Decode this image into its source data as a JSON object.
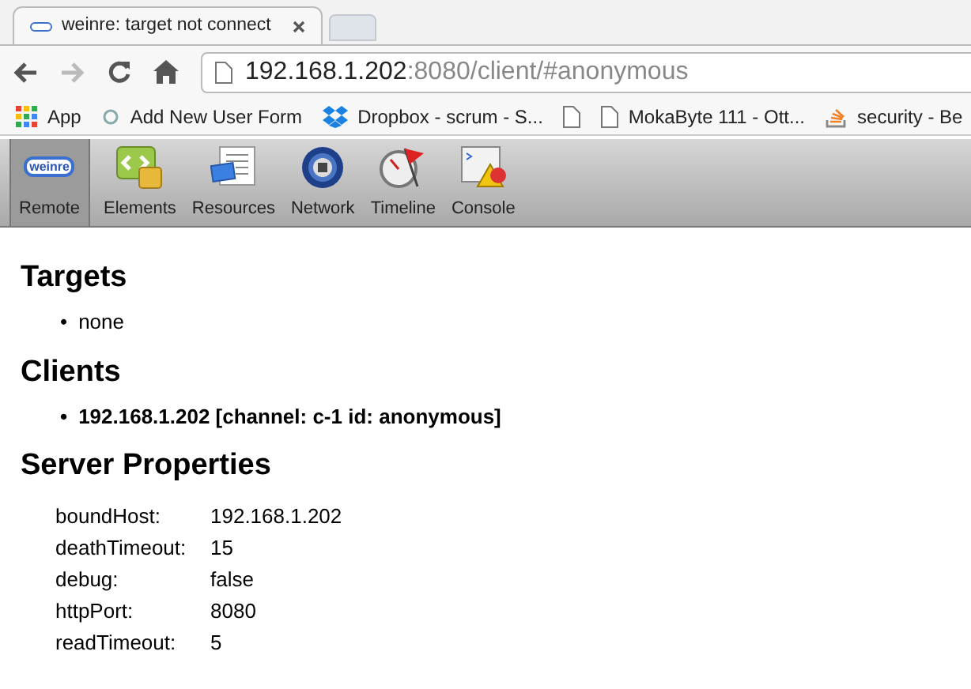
{
  "browser": {
    "tab_title": "weinre: target not connect",
    "url_host": "192.168.1.202",
    "url_rest": ":8080/client/#anonymous",
    "bookmarks": [
      {
        "kind": "apps",
        "label": "App"
      },
      {
        "kind": "link",
        "label": "Add New User Form"
      },
      {
        "kind": "dropbox",
        "label": "Dropbox - scrum - S..."
      },
      {
        "kind": "page"
      },
      {
        "kind": "page",
        "label": "MokaByte 111 - Ott..."
      },
      {
        "kind": "stack",
        "label": "security - Be"
      }
    ]
  },
  "toolbar": [
    {
      "kind": "remote",
      "label": "Remote",
      "logo": "weinre",
      "selected": true
    },
    {
      "kind": "elements",
      "label": "Elements",
      "selected": false
    },
    {
      "kind": "resources",
      "label": "Resources",
      "selected": false
    },
    {
      "kind": "network",
      "label": "Network",
      "selected": false
    },
    {
      "kind": "timeline",
      "label": "Timeline",
      "selected": false
    },
    {
      "kind": "console",
      "label": "Console",
      "selected": false
    }
  ],
  "targets": {
    "heading": "Targets",
    "items": [
      {
        "bullet": "•",
        "text": "none"
      }
    ]
  },
  "clients": {
    "heading": "Clients",
    "items": [
      {
        "bullet": "•",
        "text": "192.168.1.202 [channel: c-1 id: anonymous]"
      }
    ]
  },
  "server_properties": {
    "heading": "Server Properties",
    "rows": [
      {
        "name": "boundHost:",
        "value": "192.168.1.202"
      },
      {
        "name": "deathTimeout:",
        "value": "15"
      },
      {
        "name": "debug:",
        "value": "false"
      },
      {
        "name": "httpPort:",
        "value": "8080"
      },
      {
        "name": "readTimeout:",
        "value": "5"
      }
    ]
  }
}
